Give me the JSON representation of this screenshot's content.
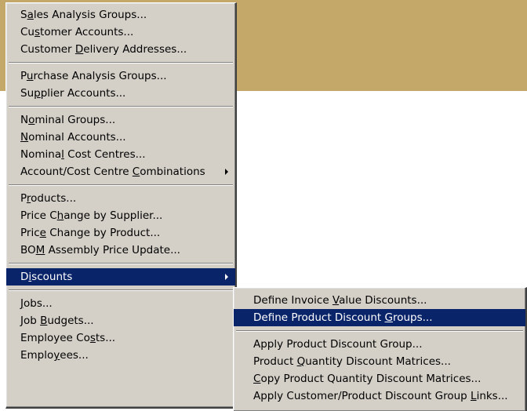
{
  "colors": {
    "menu_bg": "#d4d0c8",
    "highlight": "#0a246a",
    "highlight_text": "#ffffff",
    "band": "#c3a86a"
  },
  "menu": {
    "groups": [
      [
        {
          "pre": "S",
          "key": "a",
          "post": "les Analysis Groups..."
        },
        {
          "pre": "Cu",
          "key": "s",
          "post": "tomer Accounts..."
        },
        {
          "pre": "Customer ",
          "key": "D",
          "post": "elivery Addresses..."
        }
      ],
      [
        {
          "pre": "P",
          "key": "u",
          "post": "rchase Analysis Groups..."
        },
        {
          "pre": "Su",
          "key": "p",
          "post": "plier Accounts..."
        }
      ],
      [
        {
          "pre": "N",
          "key": "o",
          "post": "minal Groups..."
        },
        {
          "pre": "",
          "key": "N",
          "post": "ominal Accounts..."
        },
        {
          "pre": "Nomina",
          "key": "l",
          "post": " Cost Centres..."
        },
        {
          "pre": "Account/Cost Centre ",
          "key": "C",
          "post": "ombinations",
          "submenu": true
        }
      ],
      [
        {
          "pre": "P",
          "key": "r",
          "post": "oducts..."
        },
        {
          "pre": "Price C",
          "key": "h",
          "post": "ange by Supplier..."
        },
        {
          "pre": "Pric",
          "key": "e",
          "post": " Change by Product..."
        },
        {
          "pre": "BO",
          "key": "M",
          "post": " Assembly Price Update..."
        }
      ],
      [
        {
          "pre": "D",
          "key": "i",
          "post": "scounts",
          "submenu": true,
          "highlighted": true
        }
      ],
      [
        {
          "pre": "",
          "key": "J",
          "post": "obs..."
        },
        {
          "pre": "Job ",
          "key": "B",
          "post": "udgets..."
        },
        {
          "pre": "Employee Co",
          "key": "s",
          "post": "ts..."
        },
        {
          "pre": "Emplo",
          "key": "y",
          "post": "ees..."
        }
      ]
    ]
  },
  "submenu": {
    "groups": [
      [
        {
          "pre": "Define Invoice ",
          "key": "V",
          "post": "alue Discounts..."
        },
        {
          "pre": "Define Product Discount ",
          "key": "G",
          "post": "roups...",
          "highlighted": true
        }
      ],
      [
        {
          "pre": "Apply Product Discount Group...",
          "key": "",
          "post": ""
        },
        {
          "pre": "Product ",
          "key": "Q",
          "post": "uantity Discount Matrices..."
        },
        {
          "pre": "",
          "key": "C",
          "post": "opy Product Quantity Discount Matrices..."
        },
        {
          "pre": "Apply Customer/Product Discount Group ",
          "key": "L",
          "post": "inks..."
        }
      ]
    ]
  }
}
